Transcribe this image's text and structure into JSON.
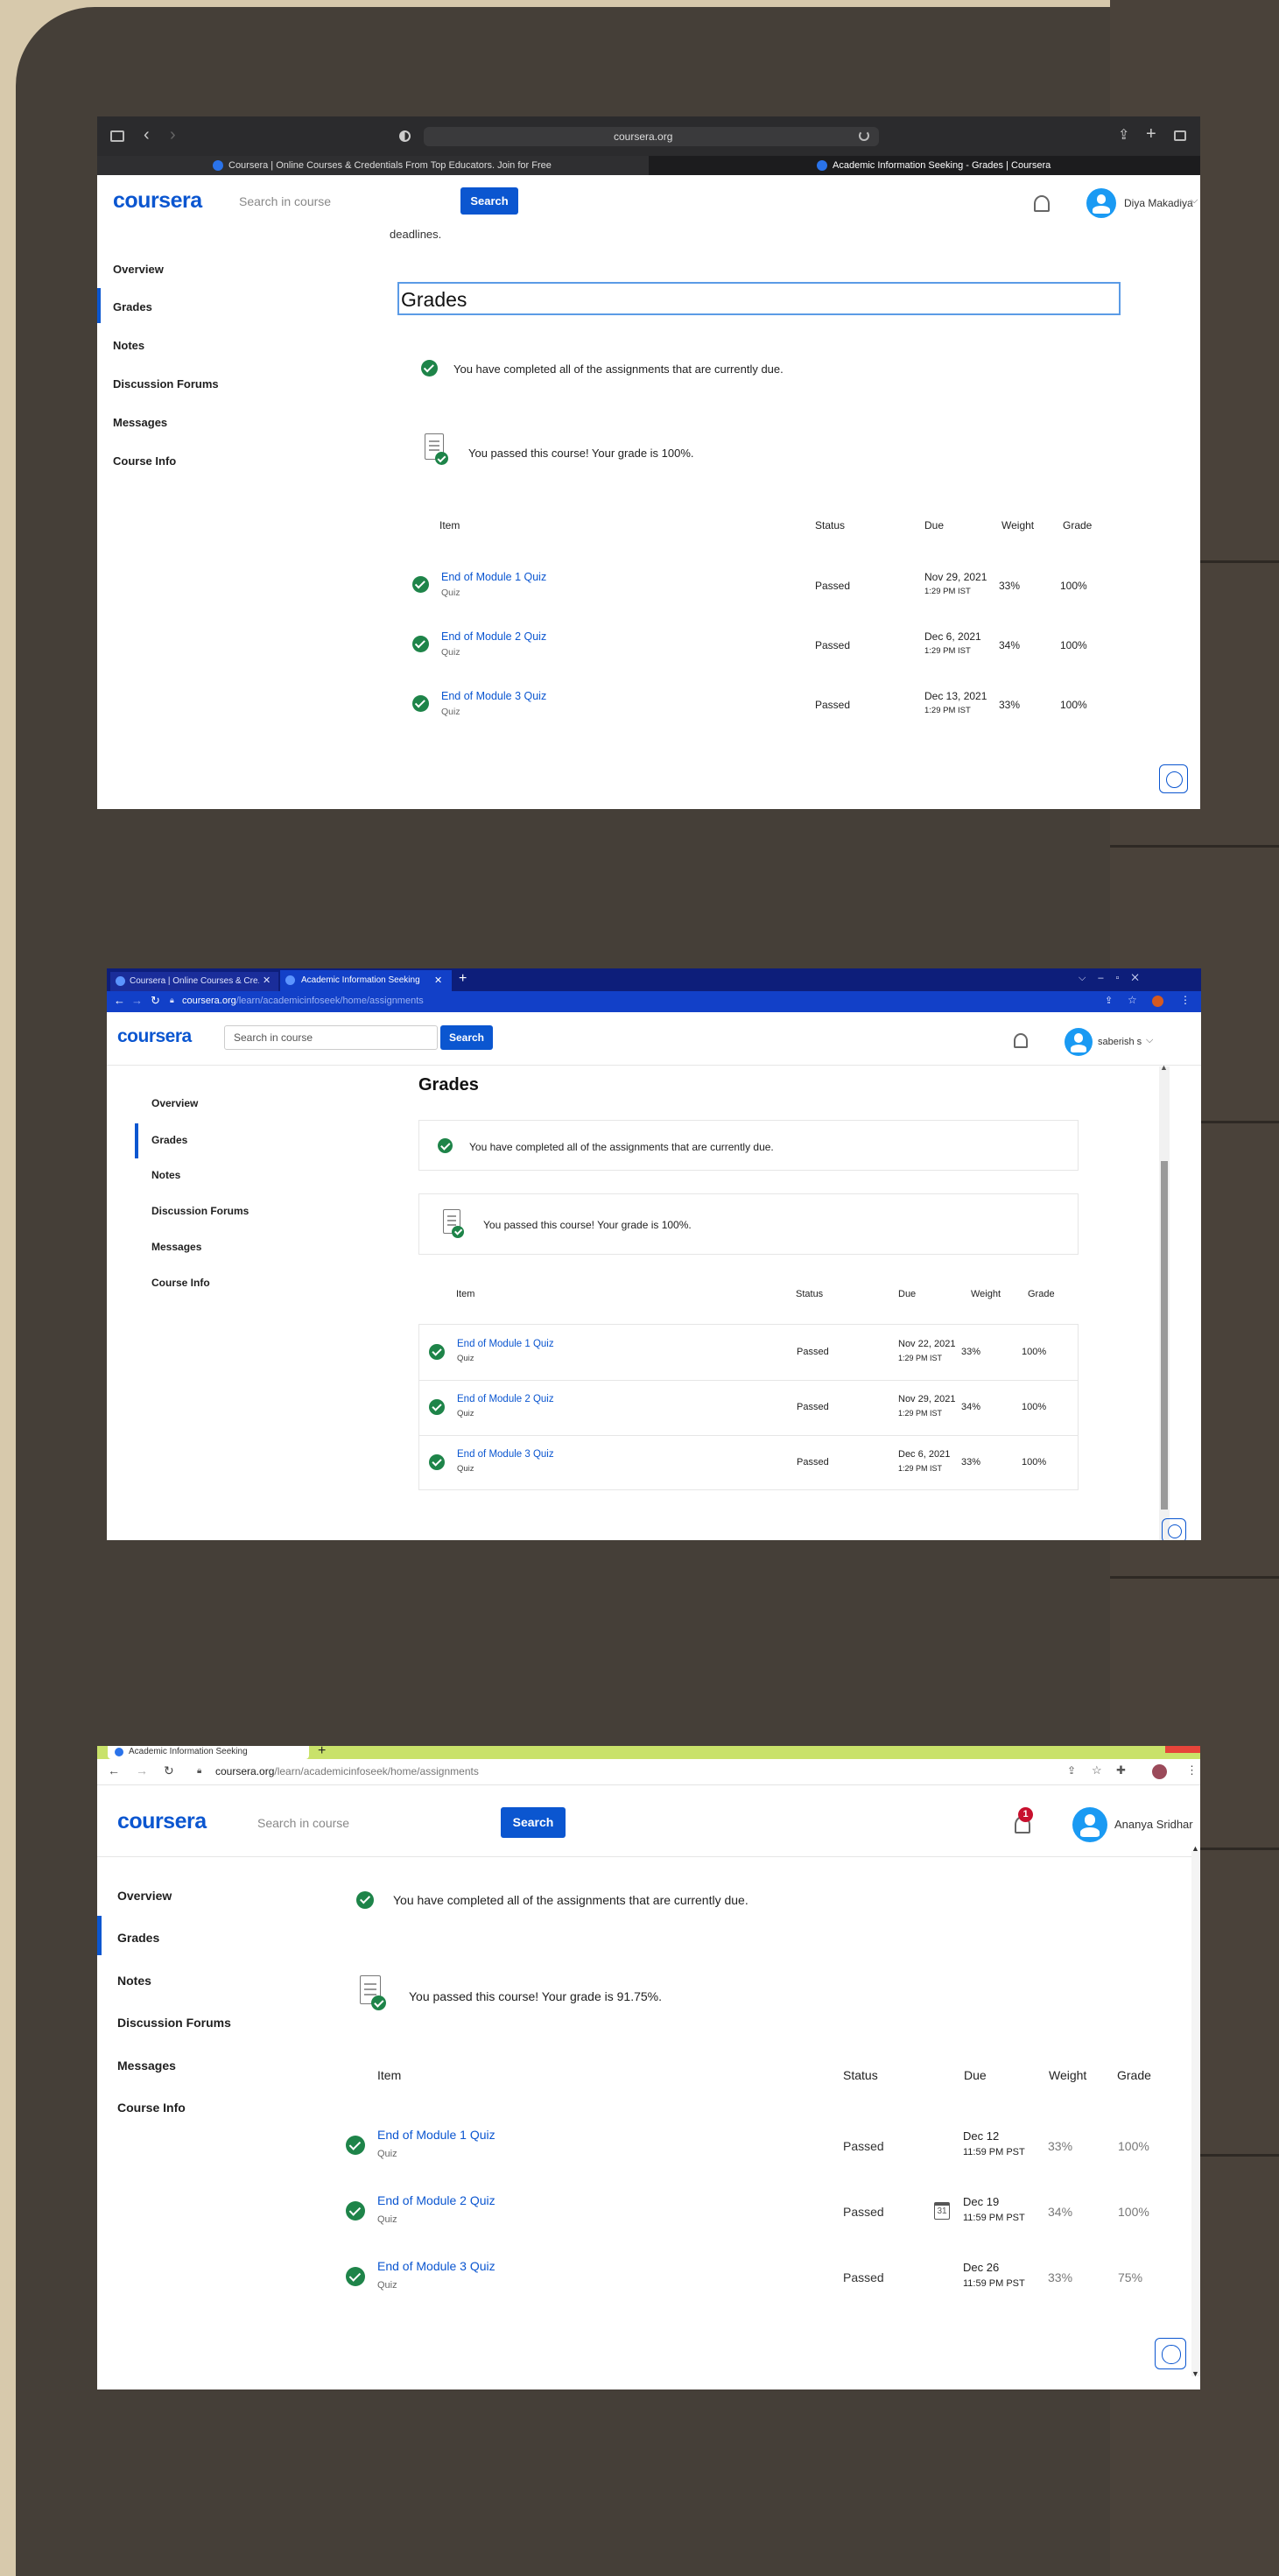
{
  "s1": {
    "address": "coursera.org",
    "tab1": "Coursera | Online Courses & Credentials From Top Educators. Join for Free",
    "tab2": "Academic Information Seeking - Grades | Coursera",
    "logo": "coursera",
    "search_placeholder": "Search in course",
    "search_btn": "Search",
    "user": "Diya Makadiya",
    "deadline_text": "deadlines.",
    "heading": "Grades",
    "completed": "You have completed all of the assignments that are currently due.",
    "passed": "You passed this course! Your grade is 100%.",
    "nav": [
      "Overview",
      "Grades",
      "Notes",
      "Discussion Forums",
      "Messages",
      "Course Info"
    ],
    "headers": [
      "Item",
      "Status",
      "Due",
      "Weight",
      "Grade"
    ],
    "rows": [
      {
        "name": "End of Module 1 Quiz",
        "type": "Quiz",
        "status": "Passed",
        "due": "Nov 29, 2021",
        "time": "1:29 PM IST",
        "weight": "33%",
        "grade": "100%"
      },
      {
        "name": "End of Module 2 Quiz",
        "type": "Quiz",
        "status": "Passed",
        "due": "Dec 6, 2021",
        "time": "1:29 PM IST",
        "weight": "34%",
        "grade": "100%"
      },
      {
        "name": "End of Module 3 Quiz",
        "type": "Quiz",
        "status": "Passed",
        "due": "Dec 13, 2021",
        "time": "1:29 PM IST",
        "weight": "33%",
        "grade": "100%"
      }
    ]
  },
  "s2": {
    "tab1": "Coursera | Online Courses & Cre...",
    "tab2": "Academic Information Seeking",
    "url_host": "coursera.org",
    "url_path": "/learn/academicinfoseek/home/assignments",
    "logo": "coursera",
    "search_placeholder": "Search in course",
    "search_btn": "Search",
    "user": "saberish s",
    "heading": "Grades",
    "completed": "You have completed all of the assignments that are currently due.",
    "passed": "You passed this course! Your grade is 100%.",
    "nav": [
      "Overview",
      "Grades",
      "Notes",
      "Discussion Forums",
      "Messages",
      "Course Info"
    ],
    "headers": [
      "Item",
      "Status",
      "Due",
      "Weight",
      "Grade"
    ],
    "rows": [
      {
        "name": "End of Module 1 Quiz",
        "type": "Quiz",
        "status": "Passed",
        "due": "Nov 22, 2021",
        "time": "1:29 PM IST",
        "weight": "33%",
        "grade": "100%"
      },
      {
        "name": "End of Module 2 Quiz",
        "type": "Quiz",
        "status": "Passed",
        "due": "Nov 29, 2021",
        "time": "1:29 PM IST",
        "weight": "34%",
        "grade": "100%"
      },
      {
        "name": "End of Module 3 Quiz",
        "type": "Quiz",
        "status": "Passed",
        "due": "Dec 6, 2021",
        "time": "1:29 PM IST",
        "weight": "33%",
        "grade": "100%"
      }
    ]
  },
  "s3": {
    "tab": "Academic Information Seeking",
    "url_host": "coursera.org",
    "url_path": "/learn/academicinfoseek/home/assignments",
    "logo": "coursera",
    "search_placeholder": "Search in course",
    "search_btn": "Search",
    "user": "Ananya Sridhar",
    "notif_count": "1",
    "completed": "You have completed all of the assignments that are currently due.",
    "passed": "You passed this course! Your grade is 91.75%.",
    "nav": [
      "Overview",
      "Grades",
      "Notes",
      "Discussion Forums",
      "Messages",
      "Course Info"
    ],
    "headers": [
      "Item",
      "Status",
      "Due",
      "Weight",
      "Grade"
    ],
    "calendar_day": "31",
    "rows": [
      {
        "name": "End of Module 1 Quiz",
        "type": "Quiz",
        "status": "Passed",
        "due": "Dec 12",
        "time": "11:59 PM PST",
        "weight": "33%",
        "grade": "100%"
      },
      {
        "name": "End of Module 2 Quiz",
        "type": "Quiz",
        "status": "Passed",
        "due": "Dec 19",
        "time": "11:59 PM PST",
        "weight": "34%",
        "grade": "100%"
      },
      {
        "name": "End of Module 3 Quiz",
        "type": "Quiz",
        "status": "Passed",
        "due": "Dec 26",
        "time": "11:59 PM PST",
        "weight": "33%",
        "grade": "75%"
      }
    ]
  }
}
